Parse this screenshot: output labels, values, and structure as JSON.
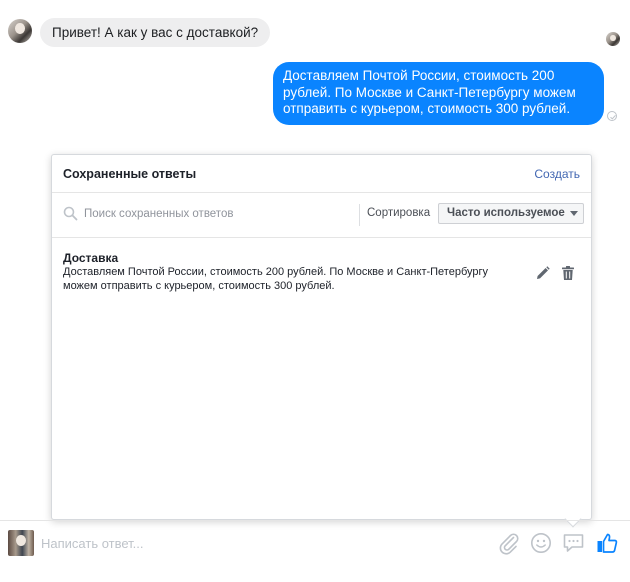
{
  "conversation": {
    "incoming_message": "Привет! А как у вас с доставкой?",
    "outgoing_message": "Доставляем Почтой России, стоимость 200 рублей. По Москве и Санкт-Петербургу можем отправить с курьером, стоимость 300 рублей."
  },
  "saved_replies": {
    "title": "Сохраненные ответы",
    "create_label": "Создать",
    "search_placeholder": "Поиск сохраненных ответов",
    "sort_label": "Сортировка",
    "sort_value": "Часто используемое",
    "items": [
      {
        "title": "Доставка",
        "text": "Доставляем Почтой России, стоимость 200 рублей. По Москве и Санкт-Петербургу можем отправить с курьером, стоимость 300 рублей."
      }
    ]
  },
  "composer": {
    "placeholder": "Написать ответ..."
  },
  "icons": {
    "search": "search-icon",
    "edit": "pencil-icon",
    "delete": "trash-icon",
    "attach": "paperclip-icon",
    "emoji": "emoji-icon",
    "saved_replies": "chat-bubble-icon",
    "like": "thumbs-up-icon"
  },
  "colors": {
    "outgoing_bubble": "#0a84ff",
    "incoming_bubble": "#eeeeef",
    "link": "#4267b2",
    "like_icon": "#0a84ff"
  }
}
